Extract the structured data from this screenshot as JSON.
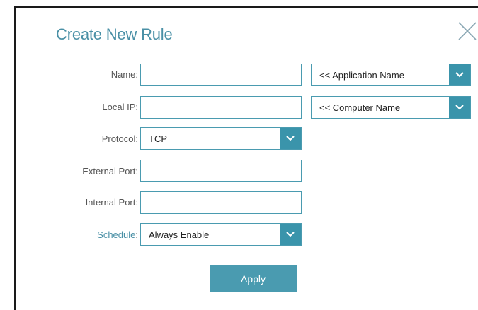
{
  "dialog": {
    "title": "Create New Rule",
    "close_icon": "close-icon"
  },
  "form": {
    "name_label": "Name:",
    "name_value": "",
    "application_select": "<< Application Name",
    "local_ip_label": "Local IP:",
    "local_ip_value": "",
    "computer_select": "<< Computer Name",
    "protocol_label": "Protocol:",
    "protocol_value": "TCP",
    "external_port_label": "External Port:",
    "external_port_value": "",
    "internal_port_label": "Internal Port:",
    "internal_port_value": "",
    "schedule_link": "Schedule",
    "schedule_colon": ":",
    "schedule_value": "Always Enable",
    "apply_label": "Apply"
  },
  "colors": {
    "accent": "#4a90a6",
    "chevron_bg": "#3a94ab",
    "button_bg": "#4a9bb0"
  }
}
